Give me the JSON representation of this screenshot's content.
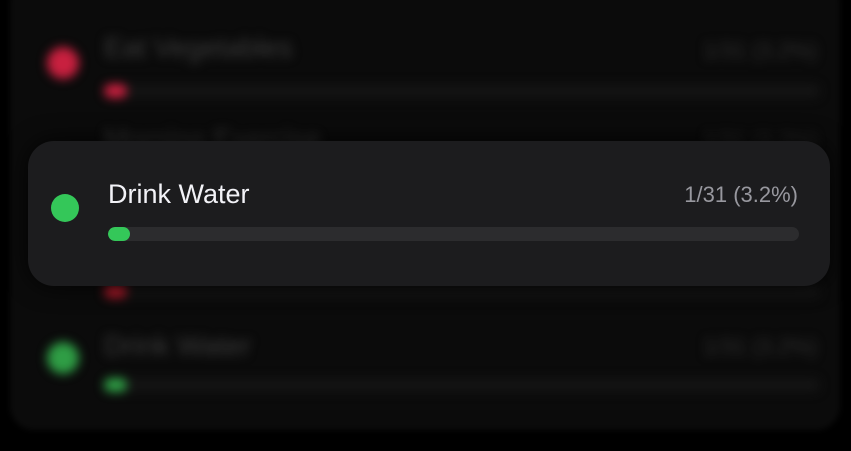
{
  "habits": [
    {
      "name": "Eat Vegetables",
      "stat": "1/31 (3.2%)",
      "progress": 0.032,
      "color": "#c8203f"
    },
    {
      "name": "Morning Exercise",
      "stat": "1/31 (3.2%)",
      "progress": 0.032,
      "color": "#c8203f"
    },
    {
      "name": "Drink Water",
      "stat": "1/31 (3.2%)",
      "progress": 0.032,
      "color": "#2f9d45"
    }
  ],
  "focused": {
    "name": "Drink Water",
    "stat": "1/31 (3.2%)",
    "progress": 0.032,
    "color": "#34c759"
  }
}
